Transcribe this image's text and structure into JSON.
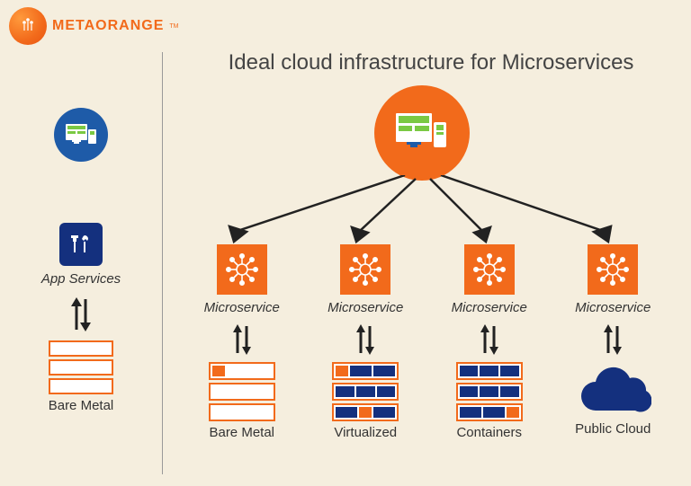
{
  "brand": {
    "name": "METAORANGE",
    "tm": "TM"
  },
  "title": "Ideal cloud infrastructure for Microservices",
  "left": {
    "app_services": "App Services",
    "bare_metal": "Bare Metal"
  },
  "ms": {
    "labels": [
      "Microservice",
      "Microservice",
      "Microservice",
      "Microservice"
    ],
    "infra": [
      "Bare Metal",
      "Virtualized",
      "Containers",
      "Public Cloud"
    ]
  }
}
